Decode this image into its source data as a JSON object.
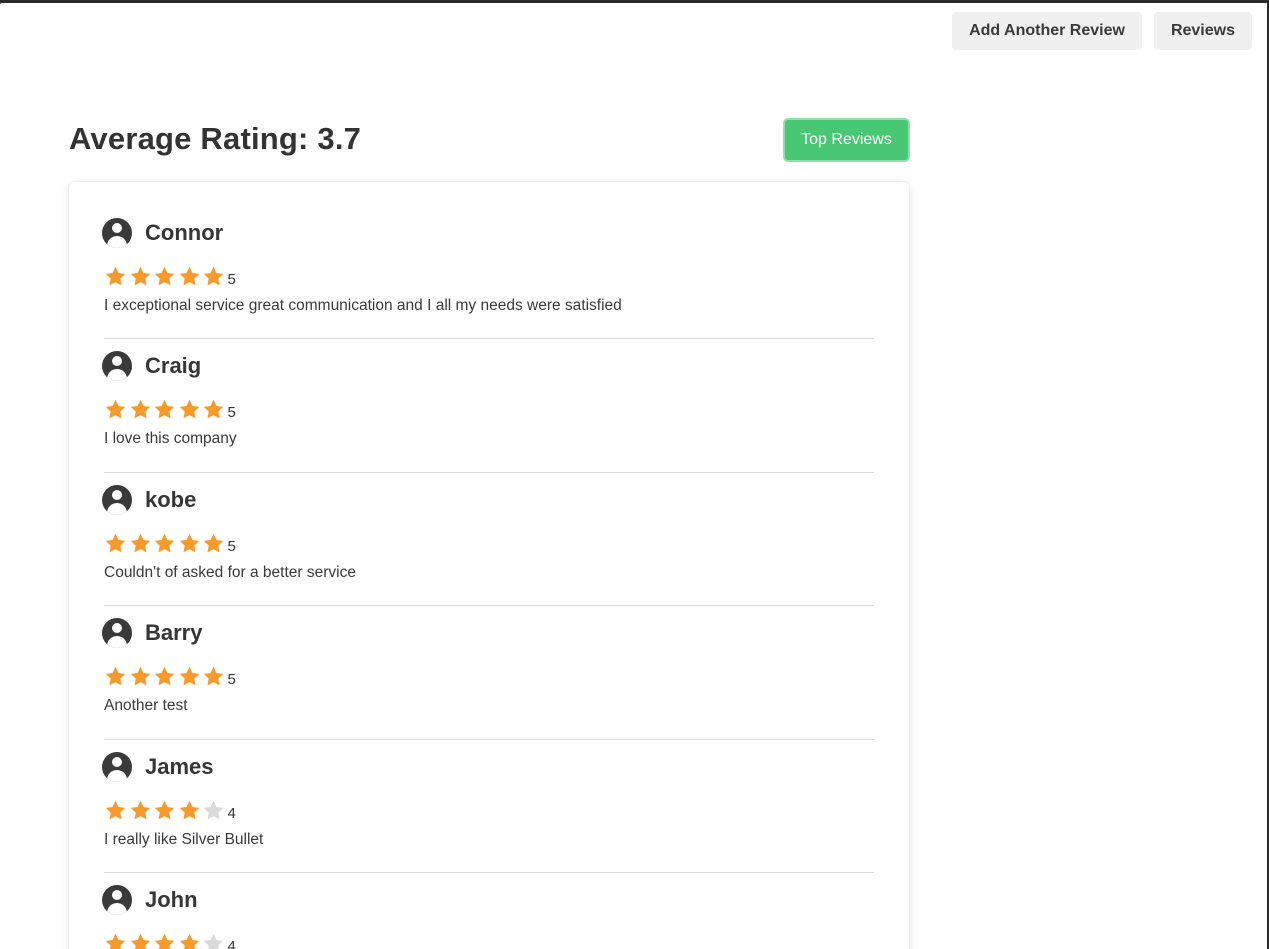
{
  "nav": {
    "add_review_label": "Add Another Review",
    "reviews_label": "Reviews"
  },
  "summary": {
    "average_label": "Average Rating: 3.7",
    "top_reviews_label": "Top Reviews"
  },
  "colors": {
    "star_filled": "#f89a2a",
    "star_empty": "#dadada",
    "accent_green": "#48c774"
  },
  "reviews": [
    {
      "name": "Connor",
      "rating": 5,
      "score_label": "5",
      "comment": "I exceptional service great communication and I all my needs were satisfied"
    },
    {
      "name": "Craig",
      "rating": 5,
      "score_label": "5",
      "comment": "I love this company"
    },
    {
      "name": "kobe",
      "rating": 5,
      "score_label": "5",
      "comment": "Couldn't of asked for a better service"
    },
    {
      "name": "Barry",
      "rating": 5,
      "score_label": "5",
      "comment": "Another test"
    },
    {
      "name": "James",
      "rating": 4,
      "score_label": "4",
      "comment": "I really like Silver Bullet"
    },
    {
      "name": "John",
      "rating": 4,
      "score_label": "4",
      "comment": ""
    }
  ]
}
